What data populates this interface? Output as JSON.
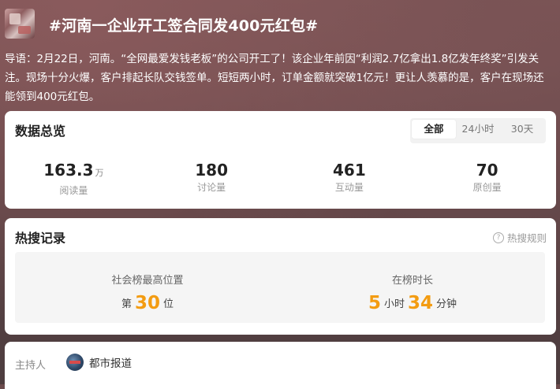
{
  "header": {
    "title": "#河南一企业开工签合同发400元红包#"
  },
  "lead": {
    "text": "导语：2月22日，河南。“全网最爱发钱老板”的公司开工了！该企业年前因“利润2.7亿拿出1.8亿发年终奖”引发关注。现场十分火爆，客户排起长队交钱签单。短短两小时，订单金额就突破1亿元！更让人羡慕的是，客户在现场还能领到400元红包。"
  },
  "overview": {
    "title": "数据总览",
    "tabs": [
      {
        "label": "全部",
        "active": true
      },
      {
        "label": "24小时",
        "active": false
      },
      {
        "label": "30天",
        "active": false
      }
    ],
    "stats": [
      {
        "value": "163.3",
        "unit": "万",
        "label": "阅读量"
      },
      {
        "value": "180",
        "unit": "",
        "label": "讨论量"
      },
      {
        "value": "461",
        "unit": "",
        "label": "互动量"
      },
      {
        "value": "70",
        "unit": "",
        "label": "原创量"
      }
    ]
  },
  "hot": {
    "title": "热搜记录",
    "rules_label": "热搜规则",
    "rank_label": "社会榜最高位置",
    "rank_prefix": "第",
    "rank_value": "30",
    "rank_suffix": "位",
    "duration_label": "在榜时长",
    "hours_value": "5",
    "hours_unit": "小时",
    "minutes_value": "34",
    "minutes_unit": "分钟"
  },
  "host": {
    "label": "主持人",
    "name": "都市报道"
  },
  "colors": {
    "accent": "#f39c12",
    "card": "#ffffff",
    "muted": "#999999"
  }
}
